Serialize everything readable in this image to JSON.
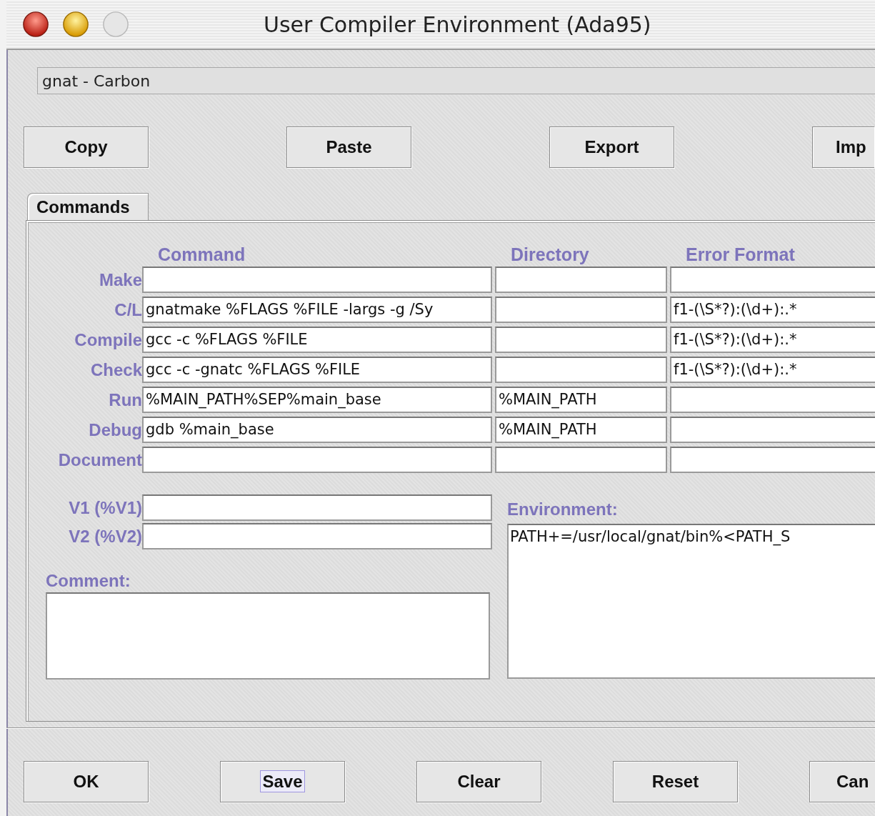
{
  "window": {
    "title": "User Compiler Environment (Ada95)"
  },
  "profile": {
    "value": "gnat - Carbon"
  },
  "top_buttons": [
    {
      "label": "Copy"
    },
    {
      "label": "Paste"
    },
    {
      "label": "Export"
    },
    {
      "label": "Imp"
    }
  ],
  "tabs": [
    {
      "label": "Commands",
      "selected": true
    }
  ],
  "columns": [
    "Command",
    "Directory",
    "Error Format"
  ],
  "rows": [
    {
      "label": "Make"
    },
    {
      "label": "C/L",
      "command": "gnatmake %FLAGS %FILE -largs -g /Sy",
      "error_format": "f1-(\\S*?):(\\d+):.*"
    },
    {
      "label": "Compile",
      "command": "gcc -c %FLAGS %FILE",
      "error_format": "f1-(\\S*?):(\\d+):.*"
    },
    {
      "label": "Check",
      "command": "gcc -c -gnatc %FLAGS %FILE",
      "error_format": "f1-(\\S*?):(\\d+):.*"
    },
    {
      "label": "Run",
      "command": "%MAIN_PATH%SEP%main_base",
      "directory": "%MAIN_PATH"
    },
    {
      "label": "Debug",
      "command": "gdb %main_base",
      "directory": "%MAIN_PATH"
    },
    {
      "label": "Document"
    }
  ],
  "variables": [
    {
      "label": "V1 (%V1)"
    },
    {
      "label": "V2 (%V2)"
    }
  ],
  "comment": {
    "label": "Comment:"
  },
  "environment": {
    "label": "Environment:",
    "value": "PATH+=/usr/local/gnat/bin%<PATH_S"
  },
  "bottom_buttons": [
    {
      "label": "OK",
      "focused": false
    },
    {
      "label": "Save",
      "focused": true
    },
    {
      "label": "Clear",
      "focused": false
    },
    {
      "label": "Reset",
      "focused": false
    },
    {
      "label": "Can",
      "focused": false
    }
  ]
}
